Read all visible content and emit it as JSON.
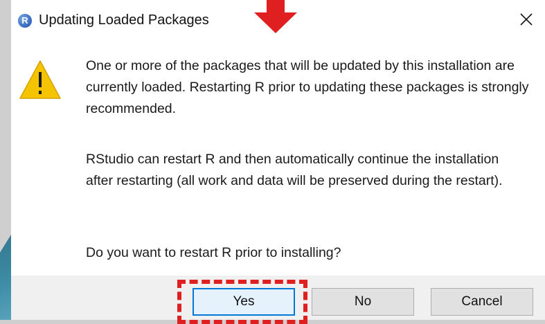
{
  "dialog": {
    "title": "Updating Loaded Packages",
    "app_icon_letter": "R",
    "icons": [
      "r-logo-icon",
      "close-icon",
      "warning-icon",
      "red-arrow-annotation"
    ],
    "messages": [
      "One or more of the packages that will be updated by this installation are currently loaded. Restarting R prior to updating these packages is strongly recommended.",
      "RStudio can restart R and then automatically continue the installation after restarting (all work and data will be preserved during the restart).",
      "Do you want to restart R prior to installing?"
    ],
    "buttons": {
      "yes": "Yes",
      "no": "No",
      "cancel": "Cancel"
    }
  },
  "colors": {
    "accent": "#0078d7",
    "annotation": "#e02020",
    "warning": "#f5c400"
  }
}
